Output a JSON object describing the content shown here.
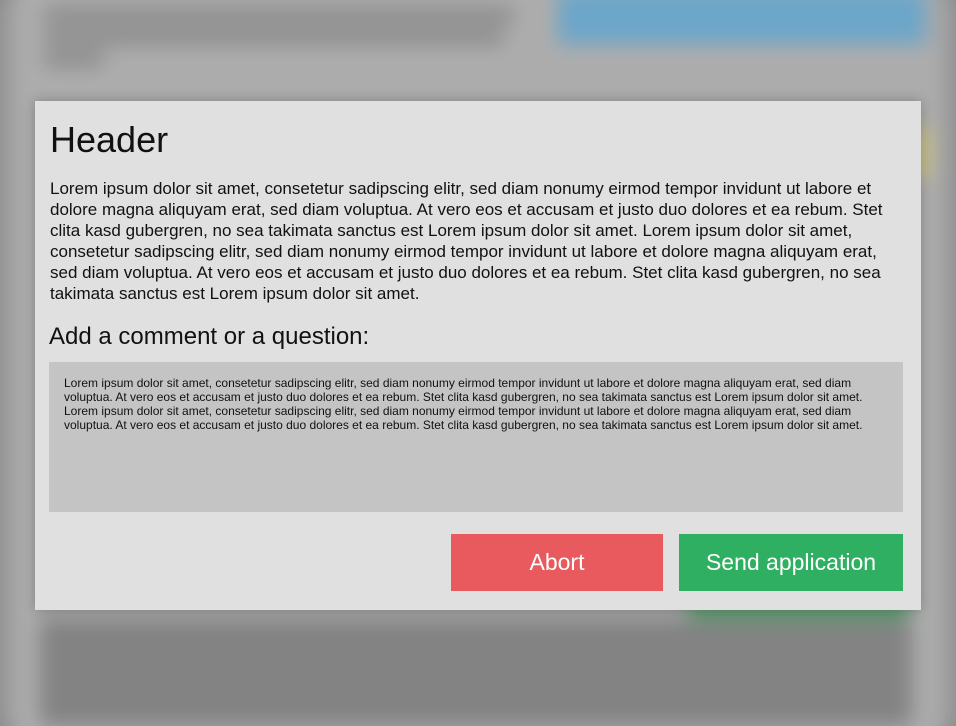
{
  "modal": {
    "title": "Header",
    "body": "Lorem ipsum dolor sit amet, consetetur sadipscing elitr, sed diam nonumy eirmod tempor invidunt ut labore et dolore magna aliquyam erat, sed diam voluptua. At vero eos et accusam et justo duo dolores et ea rebum. Stet clita kasd gubergren, no sea takimata sanctus est Lorem ipsum dolor sit amet. Lorem ipsum dolor sit amet, consetetur sadipscing elitr, sed diam nonumy eirmod tempor invidunt ut labore et dolore magna aliquyam erat, sed diam voluptua. At vero eos et accusam et justo duo dolores et ea rebum. Stet clita kasd gubergren, no sea takimata sanctus est Lorem ipsum dolor sit amet.",
    "comment_label": "Add a comment or a question:",
    "comment_value": "Lorem ipsum dolor sit amet, consetetur sadipscing elitr, sed diam nonumy eirmod tempor invidunt ut labore et dolore magna aliquyam erat, sed diam voluptua. At vero eos et accusam et justo duo dolores et ea rebum. Stet clita kasd gubergren, no sea takimata sanctus est Lorem ipsum dolor sit amet. Lorem ipsum dolor sit amet, consetetur sadipscing elitr, sed diam nonumy eirmod tempor invidunt ut labore et dolore magna aliquyam erat, sed diam voluptua. At vero eos et accusam et justo duo dolores et ea rebum. Stet clita kasd gubergren, no sea takimata sanctus est Lorem ipsum dolor sit amet.",
    "abort_label": "Abort",
    "send_label": "Send application"
  },
  "colors": {
    "abort": "#e85a5e",
    "send": "#2faf62",
    "modal_bg": "#e0e0e0",
    "comment_bg": "#c4c4c4"
  }
}
